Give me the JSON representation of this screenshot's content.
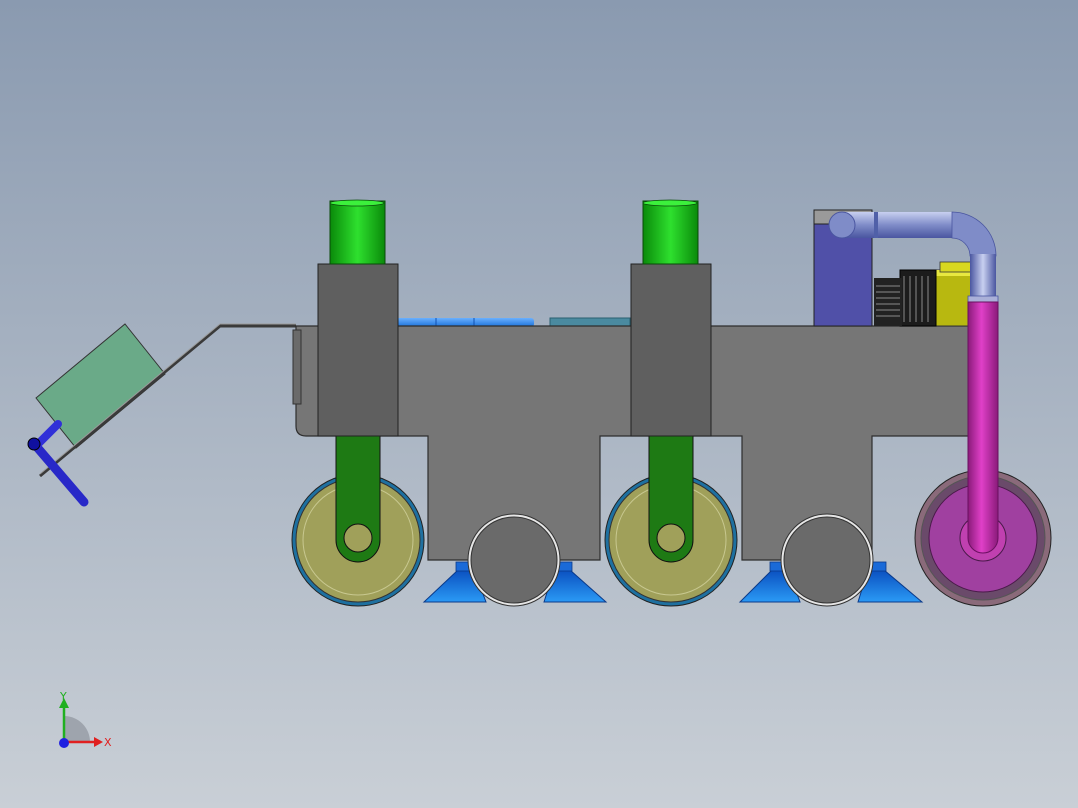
{
  "viewport": {
    "background_top": "#8a9ab0",
    "background_bottom": "#c9cfd6"
  },
  "model": {
    "body_color": "#767676",
    "column_color": "#5f5f5f",
    "leg_color": "#1e7a14",
    "motor_color": "#19c219",
    "wheel_color": "#a0a05a",
    "suction_cup_color": "#1e82e6",
    "pipe_color": "#c82dae",
    "hose_color": "#7f8cc8",
    "box_color": "#5050a8",
    "bracket_color": "#6aaa88",
    "linkage_color": "#2828c8"
  },
  "triad": {
    "x_label": "X",
    "y_label": "Y",
    "x_color": "#e02020",
    "y_color": "#20b020",
    "z_color": "#2020e0"
  }
}
